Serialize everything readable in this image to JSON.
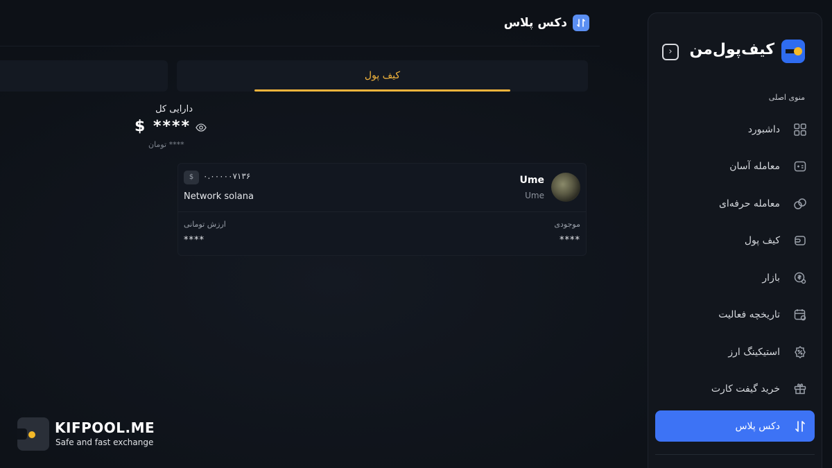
{
  "header": {
    "title": "دکس پلاس",
    "icon": "dex-plus-icon"
  },
  "tabs": [
    {
      "label": "کیف پول",
      "active": true
    },
    {
      "label": "",
      "active": false
    }
  ],
  "assets": {
    "label": "دارایی کل",
    "usd_value": "$ ****",
    "toman_value": "**** تومان"
  },
  "coin": {
    "name": "Ume",
    "symbol": "Ume",
    "price": "۰.۰۰۰۰۰۷۱۳۶",
    "currency_badge": "$",
    "network": "Network solana",
    "toman_label": "ارزش تومانی",
    "toman_value": "****",
    "balance_label": "موجودی",
    "balance_value": "****"
  },
  "sidebar": {
    "brand": "کیف‌پول‌من",
    "menu_title": "منوی اصلی",
    "items": [
      {
        "label": "داشبورد",
        "icon": "dashboard-icon",
        "active": false
      },
      {
        "label": "معامله آسان",
        "icon": "easy-trade-icon",
        "active": false
      },
      {
        "label": "معامله حرفه‌ای",
        "icon": "pro-trade-icon",
        "active": false
      },
      {
        "label": "کیف پول",
        "icon": "wallet-icon",
        "active": false
      },
      {
        "label": "بازار",
        "icon": "market-icon",
        "active": false
      },
      {
        "label": "تاریخچه فعالیت",
        "icon": "history-icon",
        "active": false
      },
      {
        "label": "استیکینگ ارز",
        "icon": "staking-icon",
        "active": false
      },
      {
        "label": "خرید گیفت کارت",
        "icon": "gift-card-icon",
        "active": false
      },
      {
        "label": "دکس پلاس",
        "icon": "dex-plus-icon",
        "active": true
      }
    ]
  },
  "watermark": {
    "title": "KIFPOOL.ME",
    "subtitle": "Safe and fast exchange"
  },
  "colors": {
    "accent": "#3d73f5",
    "tab_active": "#f2b43c",
    "background": "#0f131a"
  }
}
